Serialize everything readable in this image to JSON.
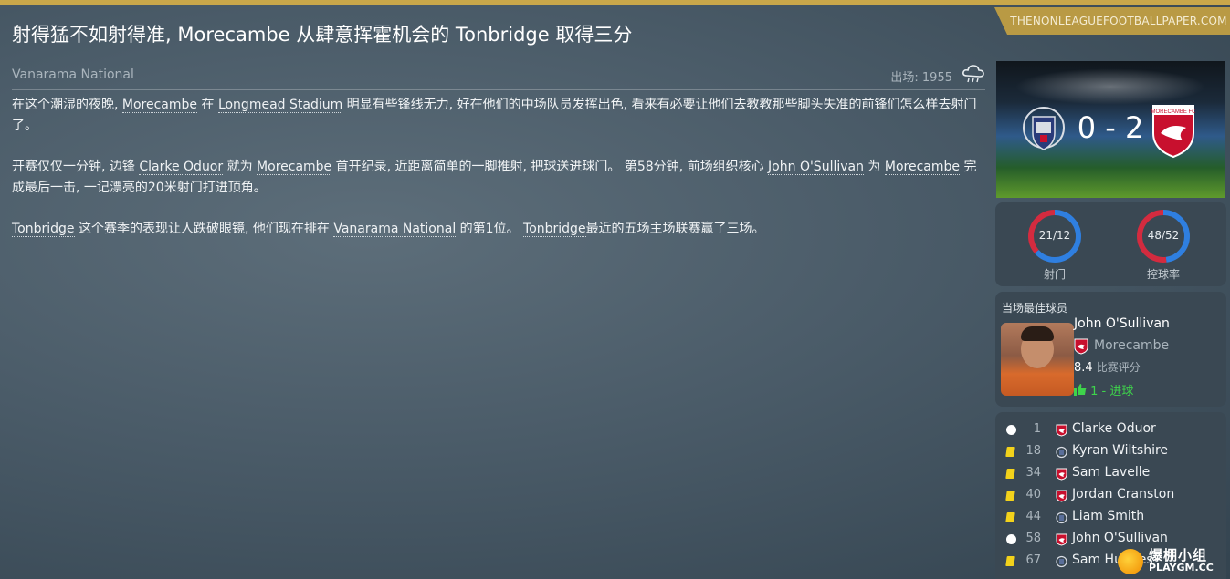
{
  "brand": "THENONLEAGUEFOOTBALLPAPER.COM",
  "headline": "射得猛不如射得准, Morecambe 从肆意挥霍机会的 Tonbridge 取得三分",
  "competition": "Vanarama National",
  "attendance": "出场: 1955",
  "weather_icon": "rain-cloud-icon",
  "article": {
    "p1": [
      {
        "t": "在这个潮湿的夜晚, "
      },
      {
        "t": "Morecambe",
        "link": true
      },
      {
        "t": " 在 "
      },
      {
        "t": "Longmead Stadium",
        "link": true
      },
      {
        "t": " 明显有些锋线无力, 好在他们的中场队员发挥出色, 看来有必要让他们去教教那些脚头失准的前锋们怎么样去射门了。"
      }
    ],
    "p2": [
      {
        "t": "开赛仅仅一分钟, 边锋 "
      },
      {
        "t": "Clarke Oduor",
        "link": true
      },
      {
        "t": " 就为 "
      },
      {
        "t": "Morecambe",
        "link": true
      },
      {
        "t": " 首开纪录, 近距离简单的一脚推射, 把球送进球门。 第58分钟, 前场组织核心 "
      },
      {
        "t": "John O'Sullivan",
        "link": true
      },
      {
        "t": " 为 "
      },
      {
        "t": "Morecambe",
        "link": true
      },
      {
        "t": " 完成最后一击, 一记漂亮的20米射门打进顶角。"
      }
    ],
    "p3": [
      {
        "t": "Tonbridge",
        "link": true
      },
      {
        "t": " 这个赛季的表现让人跌破眼镜, 他们现在排在 "
      },
      {
        "t": "Vanarama National",
        "link": true
      },
      {
        "t": " 的第1位。 "
      },
      {
        "t": "Tonbridge",
        "link": true
      },
      {
        "t": "最近的五场主场联赛赢了三场。"
      }
    ]
  },
  "score": {
    "text": "0 - 2",
    "away_crest_text": "MORECAMBE FC",
    "home_color": "#d9dde4",
    "away_color": "#c8102e"
  },
  "stats": {
    "shots": {
      "value": "21/12",
      "label": "射门",
      "home": 21,
      "away": 12
    },
    "possession": {
      "value": "48/52",
      "label": "控球率",
      "home": 48,
      "away": 52
    },
    "home_color": "#2f7fe0",
    "away_color": "#d32b3f"
  },
  "motm": {
    "title": "当场最佳球员",
    "name": "John O'Sullivan",
    "team": "Morecambe",
    "rating": "8.4",
    "rating_label": "比赛评分",
    "goals": "1 - 进球",
    "thumb_icon": "thumbs-up-icon"
  },
  "events": [
    {
      "type": "goal",
      "minute": "1",
      "team": "away",
      "player": "Clarke Oduor"
    },
    {
      "type": "yellow",
      "minute": "18",
      "team": "home",
      "player": "Kyran Wiltshire"
    },
    {
      "type": "yellow",
      "minute": "34",
      "team": "away",
      "player": "Sam Lavelle"
    },
    {
      "type": "yellow",
      "minute": "40",
      "team": "away",
      "player": "Jordan Cranston"
    },
    {
      "type": "yellow",
      "minute": "44",
      "team": "home",
      "player": "Liam Smith"
    },
    {
      "type": "goal",
      "minute": "58",
      "team": "away",
      "player": "John O'Sullivan"
    },
    {
      "type": "yellow",
      "minute": "67",
      "team": "home",
      "player": "Sam Hughes"
    }
  ],
  "watermark": {
    "line1": "爆棚小组",
    "line2": "PLAYGM.CC"
  }
}
